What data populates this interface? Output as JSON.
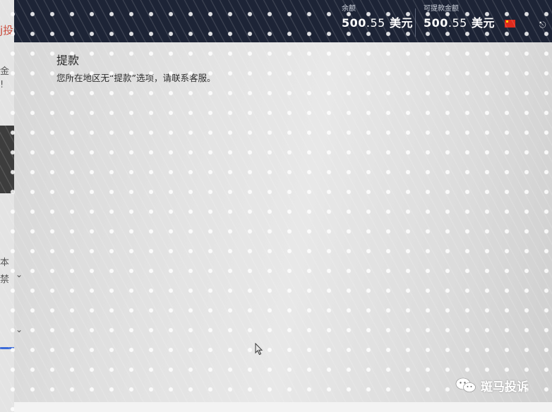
{
  "header": {
    "balance_label": "余额",
    "balance_main": "500",
    "balance_cents": ".55",
    "balance_currency": "美元",
    "withdrawable_label": "可提款金额",
    "withdrawable_main": "500",
    "withdrawable_cents": ".55",
    "withdrawable_currency": "美元",
    "flag_icon": "china-flag-icon",
    "logout_icon": "logout-icon"
  },
  "panel": {
    "title": "提款",
    "message": "您所在地区无“提款”选项，请联系客服。"
  },
  "background_page": {
    "red_text": "j投",
    "line1": "金",
    "line2": "!",
    "line3": "本",
    "line4": "禁"
  },
  "watermark": {
    "icon": "wechat-icon",
    "text": "斑马投诉"
  },
  "colors": {
    "header_bg": "#1d2436",
    "panel_bg": "#e3e3e3",
    "flag_red": "#de2a1c"
  }
}
